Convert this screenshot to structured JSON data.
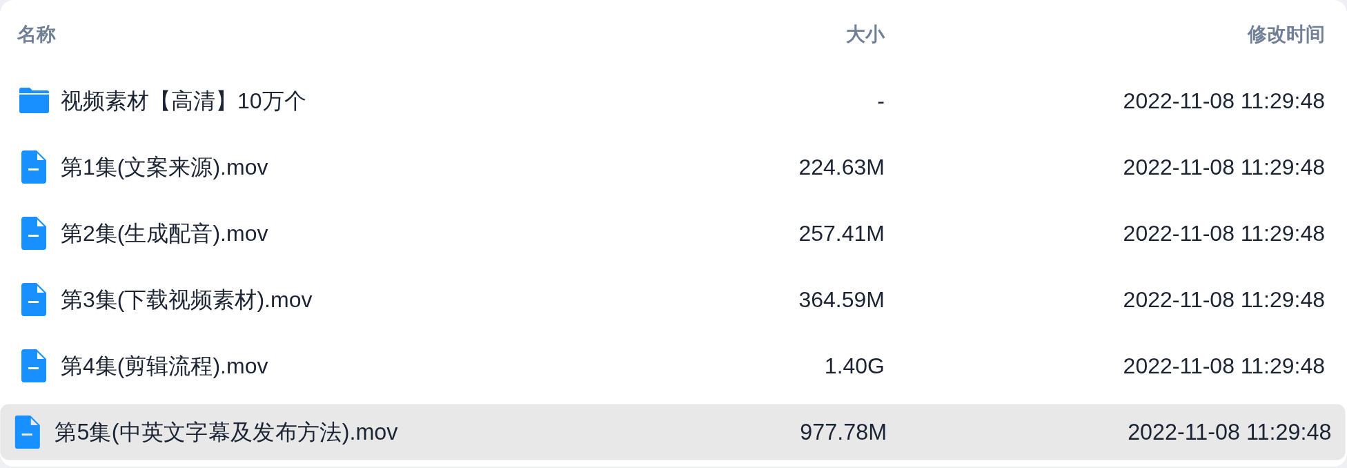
{
  "table": {
    "columns": [
      "名称",
      "大小",
      "修改时间"
    ],
    "rows": [
      {
        "kind": "folder",
        "name": "视频素材【高清】10万个",
        "size": "-",
        "modified": "2022-11-08 11:29:48",
        "selected": false
      },
      {
        "kind": "file",
        "name": "第1集(文案来源).mov",
        "size": "224.63M",
        "modified": "2022-11-08 11:29:48",
        "selected": false
      },
      {
        "kind": "file",
        "name": "第2集(生成配音).mov",
        "size": "257.41M",
        "modified": "2022-11-08 11:29:48",
        "selected": false
      },
      {
        "kind": "file",
        "name": "第3集(下载视频素材).mov",
        "size": "364.59M",
        "modified": "2022-11-08 11:29:48",
        "selected": false
      },
      {
        "kind": "file",
        "name": "第4集(剪辑流程).mov",
        "size": "1.40G",
        "modified": "2022-11-08 11:29:48",
        "selected": false
      },
      {
        "kind": "file",
        "name": "第5集(中英文字幕及发布方法).mov",
        "size": "977.78M",
        "modified": "2022-11-08 11:29:48",
        "selected": true
      }
    ]
  }
}
